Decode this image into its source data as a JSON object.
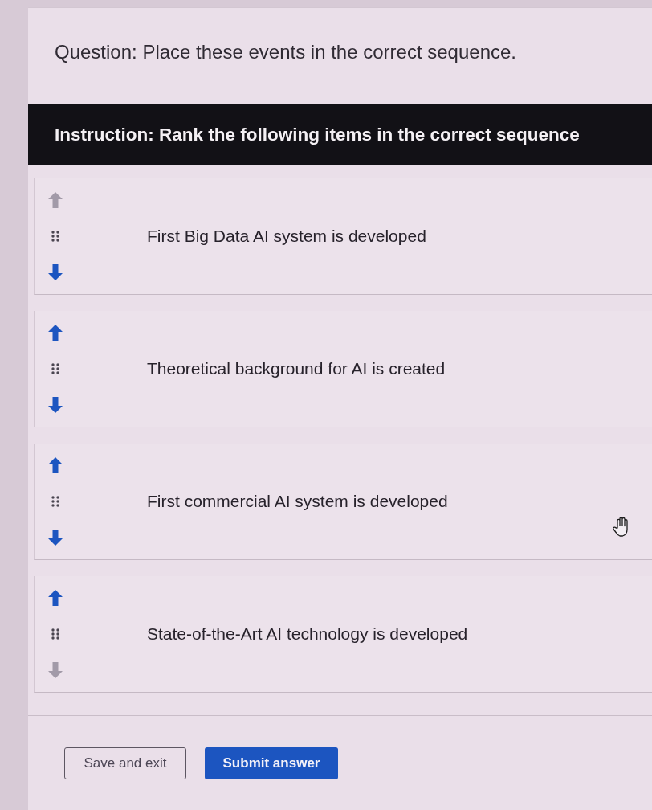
{
  "question": "Question: Place these events in the correct sequence.",
  "instruction": "Instruction: Rank the following items in the correct sequence",
  "items": [
    {
      "label": "First Big Data AI system is developed",
      "up_disabled": true,
      "down_disabled": false
    },
    {
      "label": "Theoretical background for AI is created",
      "up_disabled": false,
      "down_disabled": false
    },
    {
      "label": "First commercial AI system is developed",
      "up_disabled": false,
      "down_disabled": false
    },
    {
      "label": "State-of-the-Art AI technology is developed",
      "up_disabled": false,
      "down_disabled": true
    }
  ],
  "buttons": [
    {
      "label": "Save and exit",
      "kind": "secondary"
    },
    {
      "label": "Submit answer",
      "kind": "primary"
    }
  ]
}
